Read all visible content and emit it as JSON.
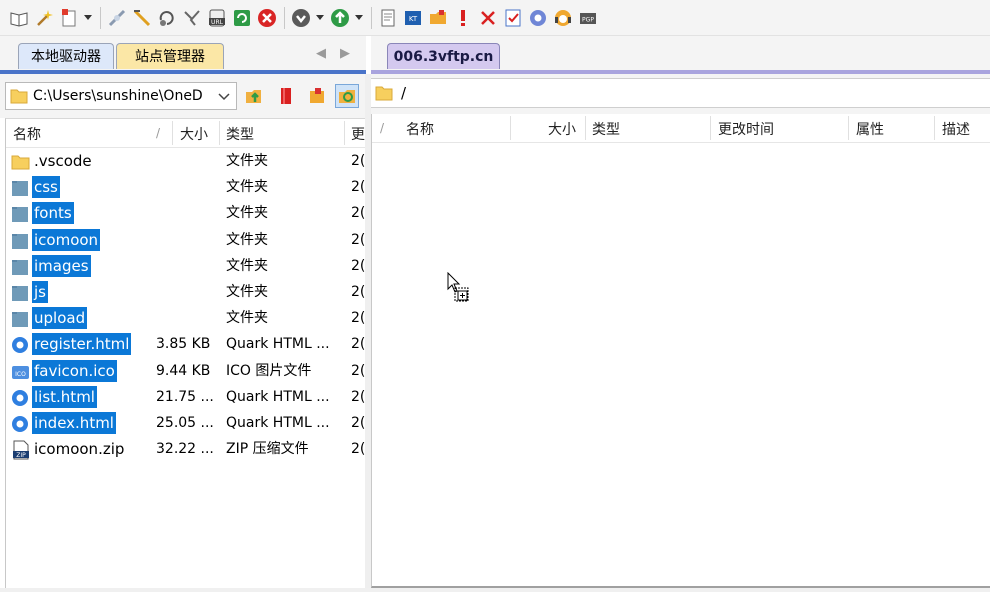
{
  "toolbar": {
    "icons": [
      "book-icon",
      "wand-icon",
      "new-session-icon",
      "dropdown-arrow",
      "connect-icon",
      "disconnect-icon",
      "reconnect-icon",
      "abort-icon",
      "url-icon",
      "refresh-icon",
      "stop-icon",
      "queue-icon",
      "dropdown-arrow",
      "go-icon",
      "dropdown-arrow",
      "edit-icon",
      "compare-icon",
      "folder-icon",
      "exclamation-icon",
      "cross-icon",
      "checklist-icon",
      "settings-icon",
      "support-icon",
      "pgp-icon"
    ]
  },
  "left_panel": {
    "tabs": {
      "local": "本地驱动器",
      "site_manager": "站点管理器"
    },
    "path": "C:\\Users\\sunshine\\OneD",
    "columns": {
      "name": "名称",
      "size": "大小",
      "type": "类型",
      "date": "更"
    },
    "files": [
      {
        "name": ".vscode",
        "size": "",
        "type": "文件夹",
        "date": "2(",
        "icon": "folder",
        "selected": false
      },
      {
        "name": "css",
        "size": "",
        "type": "文件夹",
        "date": "2(",
        "icon": "folder",
        "selected": true
      },
      {
        "name": "fonts",
        "size": "",
        "type": "文件夹",
        "date": "2(",
        "icon": "folder",
        "selected": true
      },
      {
        "name": "icomoon",
        "size": "",
        "type": "文件夹",
        "date": "2(",
        "icon": "folder",
        "selected": true
      },
      {
        "name": "images",
        "size": "",
        "type": "文件夹",
        "date": "2(",
        "icon": "folder",
        "selected": true
      },
      {
        "name": "js",
        "size": "",
        "type": "文件夹",
        "date": "2(",
        "icon": "folder",
        "selected": true
      },
      {
        "name": "upload",
        "size": "",
        "type": "文件夹",
        "date": "2(",
        "icon": "folder",
        "selected": true
      },
      {
        "name": "register.html",
        "size": "3.85 KB",
        "type": "Quark HTML ...",
        "date": "2(",
        "icon": "html",
        "selected": true
      },
      {
        "name": "favicon.ico",
        "size": "9.44 KB",
        "type": "ICO 图片文件",
        "date": "2(",
        "icon": "ico",
        "selected": true
      },
      {
        "name": "list.html",
        "size": "21.75 ...",
        "type": "Quark HTML ...",
        "date": "2(",
        "icon": "html",
        "selected": true
      },
      {
        "name": "index.html",
        "size": "25.05 ...",
        "type": "Quark HTML ...",
        "date": "2(",
        "icon": "html",
        "selected": true
      },
      {
        "name": "icomoon.zip",
        "size": "32.22 ...",
        "type": "ZIP 压缩文件",
        "date": "2(",
        "icon": "zip",
        "selected": false
      }
    ]
  },
  "right_panel": {
    "tab": "006.3vftp.cn",
    "path": "/",
    "columns": {
      "name": "名称",
      "size": "大小",
      "type": "类型",
      "modified": "更改时间",
      "attributes": "属性",
      "description": "描述"
    }
  },
  "colors": {
    "selection": "#0b78d7",
    "left_tab_line": "#4a74c9",
    "right_tab_line": "#a9a4de"
  }
}
